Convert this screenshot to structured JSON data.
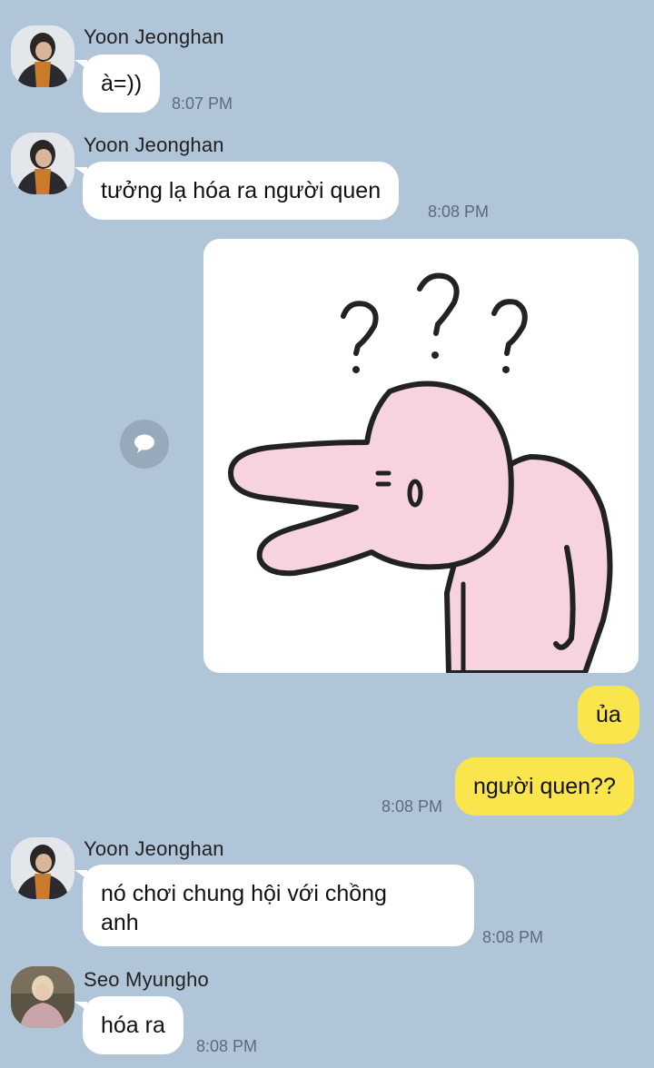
{
  "messages": {
    "m1": {
      "sender": "Yoon Jeonghan",
      "text": "à=))",
      "time": "8:07 PM"
    },
    "m2": {
      "sender": "Yoon Jeonghan",
      "text": "tưởng lạ hóa ra người quen",
      "time": "8:08 PM"
    },
    "m3": {
      "sticker": "confused-pink-rabbit-sticker"
    },
    "m4": {
      "text": "ủa"
    },
    "m5": {
      "text": "người quen??",
      "time": "8:08 PM"
    },
    "m6": {
      "sender": "Yoon Jeonghan",
      "line1": "nó chơi chung hội với chồng",
      "line2": "anh",
      "time": "8:08 PM"
    },
    "m7": {
      "sender": "Seo Myungho",
      "text": "hóa ra",
      "time": "8:08 PM"
    }
  },
  "icons": {
    "reply": "speech-bubble-icon"
  },
  "colors": {
    "background": "#b1c5d9",
    "incoming_bubble": "#ffffff",
    "outgoing_bubble": "#fbe54c",
    "sticker_pink": "#f7d3e1"
  }
}
